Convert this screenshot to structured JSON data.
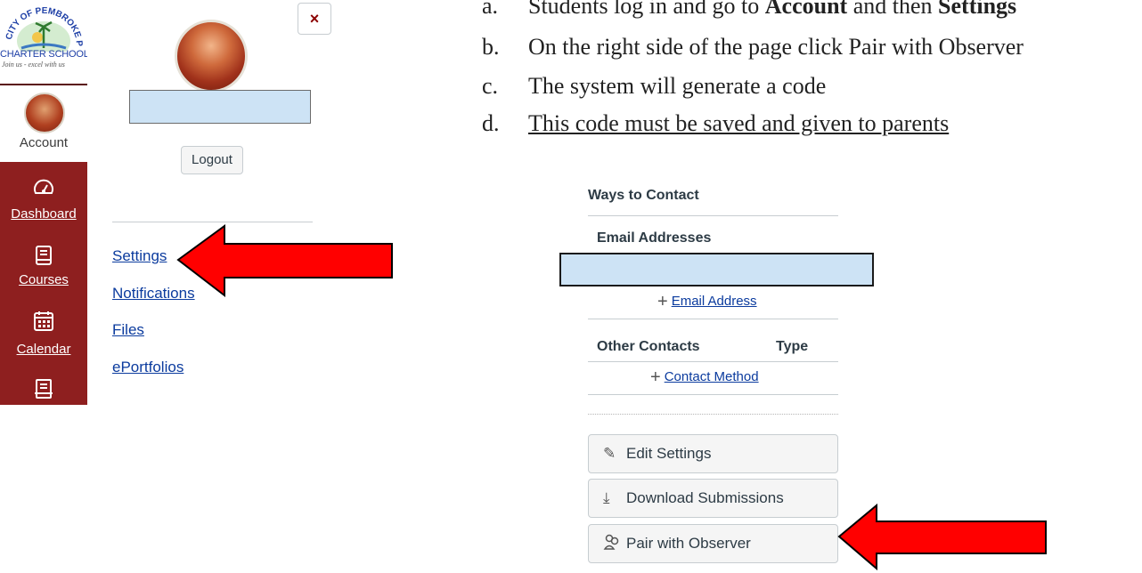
{
  "logo": {
    "arc_text": "CITY OF PEMBROKE PINES",
    "school": "CHARTER SCHOOL",
    "tagline": "Join us - excel with us"
  },
  "global_nav": {
    "account_label": "Account",
    "items": [
      {
        "label": "Dashboard",
        "icon": "dashboard-gauge-icon"
      },
      {
        "label": "Courses",
        "icon": "book-icon"
      },
      {
        "label": "Calendar",
        "icon": "calendar-icon"
      },
      {
        "label": "",
        "icon": "inbox-icon"
      }
    ]
  },
  "account_tray": {
    "close_symbol": "×",
    "logout_label": "Logout",
    "links": [
      "Settings",
      "Notifications",
      "Files",
      "ePortfolios"
    ]
  },
  "instructions": [
    {
      "letter": "a.",
      "text_before": "Students log in and go to ",
      "bold1": "Account",
      "text_mid": " and then ",
      "bold2": "Settings"
    },
    {
      "letter": "b.",
      "text": "On the right side of the page click Pair with Observer"
    },
    {
      "letter": "c.",
      "text": "The system will generate a code"
    },
    {
      "letter": "d.",
      "text": "This code must be saved and given to parents"
    }
  ],
  "settings_panel": {
    "ways_to_contact": "Ways to Contact",
    "email_addresses": "Email Addresses",
    "add_email_label": "Email Address",
    "other_contacts": "Other Contacts",
    "type_header": "Type",
    "add_contact_label": "Contact Method",
    "buttons": [
      {
        "label": "Edit Settings",
        "icon": "pencil-icon"
      },
      {
        "label": "Download Submissions",
        "icon": "download-icon"
      },
      {
        "label": "Pair with Observer",
        "icon": "observer-pair-icon"
      }
    ]
  },
  "colors": {
    "nav_bg": "#8e1f1f",
    "arrow": "#ff0000",
    "redaction": "#cde3f5",
    "link": "#0b3b9e"
  }
}
